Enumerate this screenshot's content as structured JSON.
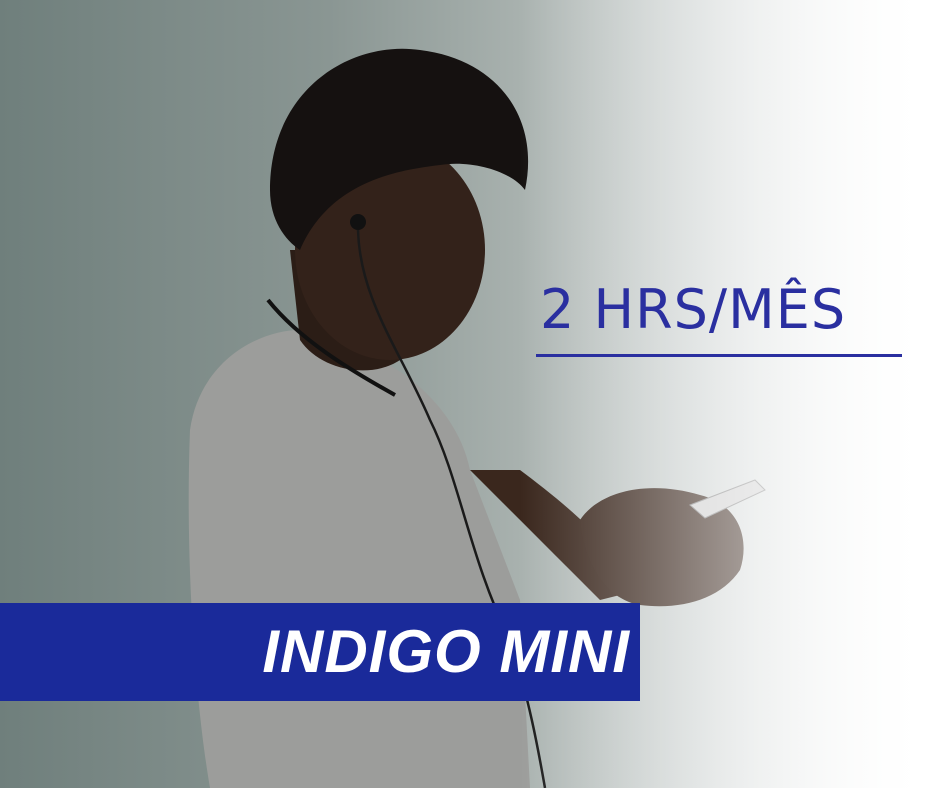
{
  "promo": {
    "duration": "2 HRS/MÊS",
    "plan_name": "INDIGO MINI"
  },
  "colors": {
    "accent": "#2a2fa0",
    "banner": "#1a2a9a",
    "wall": "#7c8a87",
    "shirt": "#9e9e9c"
  },
  "photo": {
    "subject": "smiling man with earphones looking at smartphone"
  }
}
